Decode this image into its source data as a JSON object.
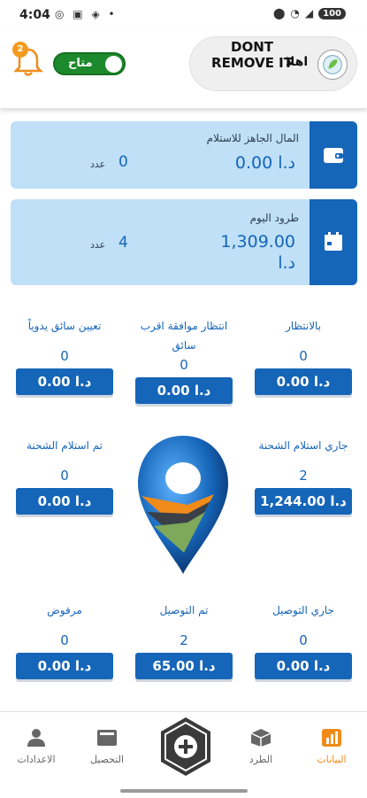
{
  "status_bar": {
    "time": "4:04",
    "battery": "100"
  },
  "header": {
    "notification_count": "2",
    "toggle_label": "متاح",
    "user_name": "DONT REMOVE IT",
    "greeting": "اهلا"
  },
  "cards": [
    {
      "title": "المال الجاهز للاستلام",
      "amount": "0.00 د.ا",
      "count": "0",
      "count_unit": "عدد",
      "icon": "wallet-icon"
    },
    {
      "title": "طرود اليوم",
      "amount": "1,309.00 د.ا",
      "count": "4",
      "count_unit": "عدد",
      "icon": "calendar-icon"
    }
  ],
  "stats": {
    "waiting": {
      "title": "بالانتظار",
      "count": "0",
      "amount": "0.00 د.ا"
    },
    "awaiting_driver": {
      "title": "انتظار موافقة اقرب سائق",
      "count": "0",
      "amount": "0.00 د.ا"
    },
    "assign_driver": {
      "title": "تعيين سائق يدوياً",
      "count": "0",
      "amount": "0.00 د.ا"
    },
    "pickup_in_progress": {
      "title": "جاري استلام الشحنة",
      "count": "2",
      "amount": "1,244.00 د.ا"
    },
    "picked_up": {
      "title": "تم استلام الشحنة",
      "count": "0",
      "amount": "0.00 د.ا"
    },
    "delivering": {
      "title": "جاري التوصيل",
      "count": "0",
      "amount": "0.00 د.ا"
    },
    "delivered": {
      "title": "تم التوصيل",
      "count": "2",
      "amount": "65.00 د.ا"
    },
    "rejected": {
      "title": "مرفوض",
      "count": "0",
      "amount": "0.00 د.ا"
    }
  },
  "nav": {
    "data": "البيانات",
    "parcels": "الطرد",
    "collection": "التحصيل",
    "settings": "الاعدادات"
  },
  "colors": {
    "primary": "#1565b8",
    "card_bg": "#bfe0f7",
    "accent": "#f08b1a",
    "toggle": "#1c8a2c"
  }
}
